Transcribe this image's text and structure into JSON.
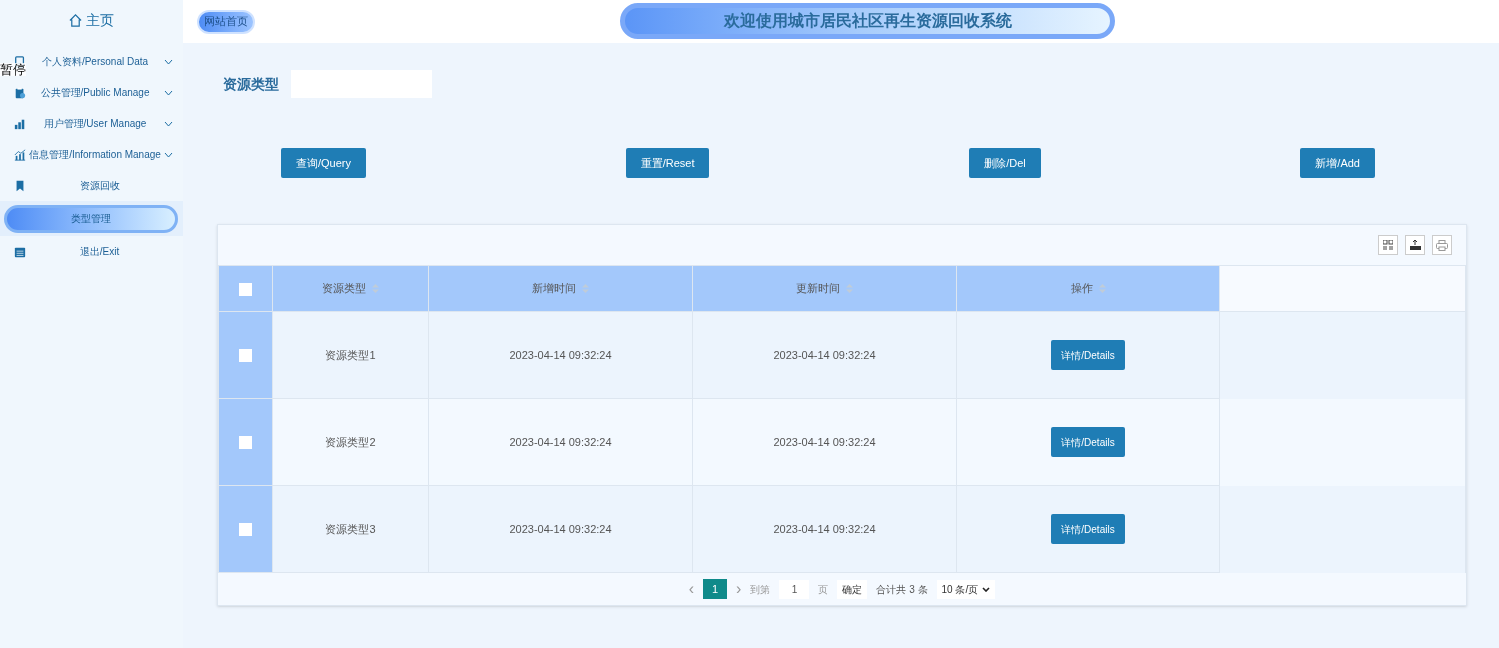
{
  "sidebar": {
    "home": "主页",
    "items": [
      {
        "label": "个人资料/Personal Data",
        "expandable": true,
        "selected": false
      },
      {
        "label": "公共管理/Public Manage",
        "expandable": true,
        "selected": false
      },
      {
        "label": "用户管理/User Manage",
        "expandable": true,
        "selected": false
      },
      {
        "label": "信息管理/Information Manage",
        "expandable": true,
        "selected": false
      },
      {
        "label": "资源回收",
        "expandable": false,
        "selected": false
      },
      {
        "label": "类型管理",
        "expandable": false,
        "selected": true
      },
      {
        "label": "退出/Exit",
        "expandable": false,
        "selected": false
      }
    ]
  },
  "overlay_text": "暂停",
  "header": {
    "home_link": "网站首页",
    "title": "欢迎使用城市居民社区再生资源回收系统"
  },
  "search": {
    "label": "资源类型"
  },
  "buttons": [
    "查询/Query",
    "重置/Reset",
    "删除/Del",
    "新增/Add"
  ],
  "table": {
    "select_all_checked": false,
    "columns": [
      "资源类型",
      "新增时间",
      "更新时间",
      "操作"
    ],
    "rows": [
      {
        "checked": false,
        "cells": [
          "资源类型1",
          "2023-04-14 09:32:24",
          "2023-04-14 09:32:24"
        ],
        "action": "详情/Details"
      },
      {
        "checked": false,
        "cells": [
          "资源类型2",
          "2023-04-14 09:32:24",
          "2023-04-14 09:32:24"
        ],
        "action": "详情/Details"
      },
      {
        "checked": false,
        "cells": [
          "资源类型3",
          "2023-04-14 09:32:24",
          "2023-04-14 09:32:24"
        ],
        "action": "详情/Details"
      }
    ]
  },
  "pagination": {
    "prev": "‹",
    "page": "1",
    "next": "›",
    "goto_label": "到第",
    "goto_value": "1",
    "page_unit": "页",
    "confirm": "确定",
    "total": "合计共 3 条",
    "page_size": "10 条/页"
  }
}
